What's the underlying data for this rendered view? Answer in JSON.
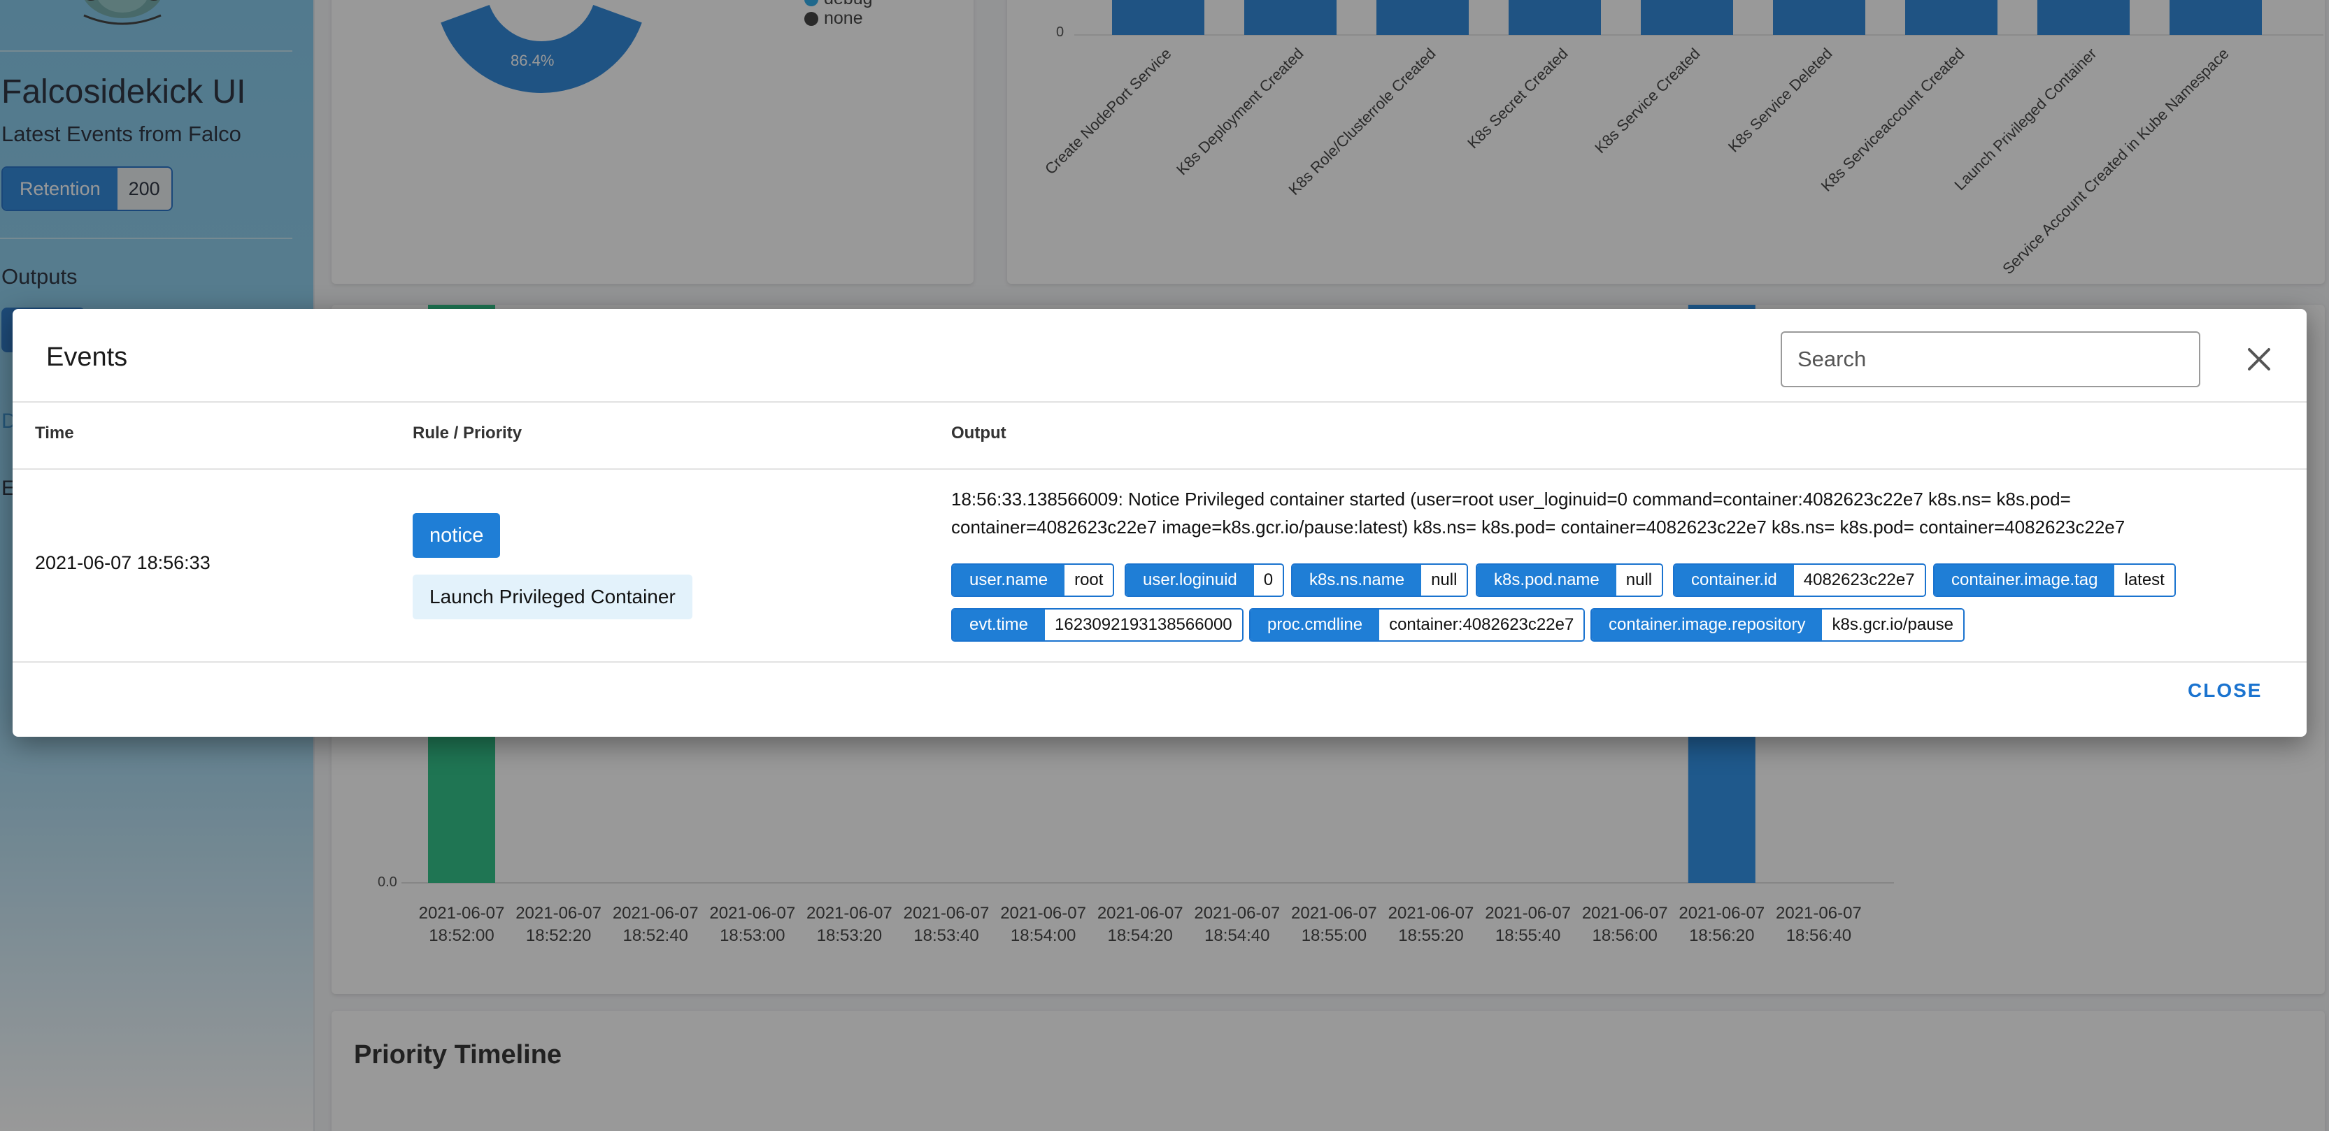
{
  "sidebar": {
    "title": "Falcosidekick UI",
    "subtitle": "Latest Events from Falco",
    "retention_label": "Retention",
    "retention_value": "200",
    "outputs_label": "Outputs",
    "fragment_d": "D",
    "fragment_e": "E"
  },
  "donut": {
    "percent_label": "86.4%",
    "legend": [
      {
        "name": "debug",
        "color": "#1fa4e8"
      },
      {
        "name": "none",
        "color": "#333333"
      }
    ],
    "main_color": "#1f7ed6"
  },
  "rules_chart": {
    "chart_data": {
      "type": "bar",
      "y_tick_zero": "0",
      "categories": [
        "Create NodePort Service",
        "K8s Deployment Created",
        "K8s Role/Clusterrole Created",
        "K8s Secret Created",
        "K8s Service Created",
        "K8s Service Deleted",
        "K8s Serviceaccount Created",
        "Launch Privileged Container",
        "Service Account Created in Kube Namespace"
      ],
      "bar_color": "#1f7ed6"
    }
  },
  "timeline_chart": {
    "chart_data": {
      "type": "bar",
      "y_tick_zero": "0.0",
      "x": [
        [
          "2021-06-07",
          "18:52:00"
        ],
        [
          "2021-06-07",
          "18:52:20"
        ],
        [
          "2021-06-07",
          "18:52:40"
        ],
        [
          "2021-06-07",
          "18:53:00"
        ],
        [
          "2021-06-07",
          "18:53:20"
        ],
        [
          "2021-06-07",
          "18:53:40"
        ],
        [
          "2021-06-07",
          "18:54:00"
        ],
        [
          "2021-06-07",
          "18:54:20"
        ],
        [
          "2021-06-07",
          "18:54:40"
        ],
        [
          "2021-06-07",
          "18:55:00"
        ],
        [
          "2021-06-07",
          "18:55:20"
        ],
        [
          "2021-06-07",
          "18:55:40"
        ],
        [
          "2021-06-07",
          "18:56:00"
        ],
        [
          "2021-06-07",
          "18:56:20"
        ],
        [
          "2021-06-07",
          "18:56:40"
        ]
      ],
      "bars": [
        {
          "index": 0,
          "color": "#1ebc7e"
        },
        {
          "index": 13,
          "color": "#1f8ae8"
        }
      ]
    }
  },
  "priority_timeline": {
    "title": "Priority Timeline"
  },
  "dialog": {
    "title": "Events",
    "search_placeholder": "Search",
    "headers": {
      "time": "Time",
      "rule": "Rule / Priority",
      "output": "Output"
    },
    "row": {
      "time": "2021-06-07 18:56:33",
      "priority": "notice",
      "rule": "Launch Privileged Container",
      "output": "18:56:33.138566009: Notice Privileged container started (user=root user_loginuid=0 command=container:4082623c22e7 k8s.ns= k8s.pod= container=4082623c22e7 image=k8s.gcr.io/pause:latest) k8s.ns= k8s.pod= container=4082623c22e7 k8s.ns= k8s.pod= container=4082623c22e7",
      "fields": [
        {
          "k": "user.name",
          "v": "root"
        },
        {
          "k": "user.loginuid",
          "v": "0"
        },
        {
          "k": "k8s.ns.name",
          "v": "null"
        },
        {
          "k": "k8s.pod.name",
          "v": "null"
        },
        {
          "k": "container.id",
          "v": "4082623c22e7"
        },
        {
          "k": "container.image.tag",
          "v": "latest"
        },
        {
          "k": "evt.time",
          "v": "1623092193138566000"
        },
        {
          "k": "proc.cmdline",
          "v": "container:4082623c22e7"
        },
        {
          "k": "container.image.repository",
          "v": "k8s.gcr.io/pause"
        }
      ]
    },
    "close_label": "CLOSE"
  }
}
